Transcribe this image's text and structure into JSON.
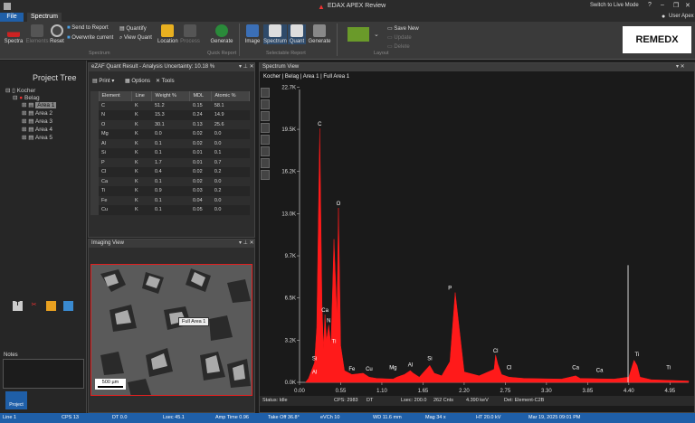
{
  "window": {
    "title": "EDAX APEX Review",
    "live_mode": "Switch to Live Mode",
    "user": "User Apex"
  },
  "menu": {
    "file": "File",
    "spectrum": "Spectrum"
  },
  "ribbon": {
    "spectra": "Spectra",
    "elements": "Elements",
    "reset": "Reset",
    "send_to_report": "Send to Report",
    "overwrite_current": "Overwrite current",
    "quantify": "Quantify",
    "view_quant": "View Quant",
    "location": "Location",
    "process": "Process",
    "generate": "Generate",
    "image": "Image",
    "spectrum": "Spectrum",
    "quant": "Quant",
    "generate2": "Generate",
    "save_new": "Save New",
    "update": "Update",
    "delete": "Delete",
    "grp_spectrum": "Spectrum",
    "grp_quick_report": "Quick Report",
    "grp_selectable_report": "Selectable Report",
    "grp_layout": "Layout",
    "logo": "REMEDX"
  },
  "project_tree": {
    "title": "Project Tree",
    "root": "Kocher",
    "sample": "Belag",
    "areas": [
      "Area 1",
      "Area 2",
      "Area 3",
      "Area 4",
      "Area 5"
    ],
    "notes": "Notes",
    "project_btn": "Project"
  },
  "quant": {
    "title": "eZAF Quant Result - Analysis Uncertainty: 10.18 %",
    "print": "Print",
    "options": "Options",
    "tools": "Tools",
    "headers": [
      "Element",
      "Line",
      "Weight %",
      "MDL",
      "Atomic %"
    ],
    "rows": [
      [
        "C",
        "K",
        "51.2",
        "0.15",
        "58.1"
      ],
      [
        "N",
        "K",
        "15.3",
        "0.24",
        "14.9"
      ],
      [
        "O",
        "K",
        "30.1",
        "0.13",
        "25.6"
      ],
      [
        "Mg",
        "K",
        "0.0",
        "0.02",
        "0.0"
      ],
      [
        "Al",
        "K",
        "0.1",
        "0.02",
        "0.0"
      ],
      [
        "Si",
        "K",
        "0.1",
        "0.01",
        "0.1"
      ],
      [
        "P",
        "K",
        "1.7",
        "0.01",
        "0.7"
      ],
      [
        "Cl",
        "K",
        "0.4",
        "0.02",
        "0.2"
      ],
      [
        "Ca",
        "K",
        "0.1",
        "0.02",
        "0.0"
      ],
      [
        "Ti",
        "K",
        "0.9",
        "0.03",
        "0.2"
      ],
      [
        "Fe",
        "K",
        "0.1",
        "0.04",
        "0.0"
      ],
      [
        "Cu",
        "K",
        "0.1",
        "0.05",
        "0.0"
      ]
    ]
  },
  "imaging": {
    "title": "Imaging View",
    "label": "Full Area 1",
    "scale": "500 µm"
  },
  "spectrum": {
    "title": "Spectrum View",
    "breadcrumb": "Kocher | Belag | Area 1 | Full Area 1",
    "status": "Status: Idle",
    "cps": "CPS: 2983",
    "dt": "DT",
    "lsec": "Lsec: 200.0",
    "cnts": "262 Cnts",
    "kev": "4.390 keV",
    "det": "Det: Element-C2B"
  },
  "chart_data": {
    "type": "line",
    "xlabel": "",
    "ylabel": "",
    "xlim": [
      0,
      5.2
    ],
    "ylim": [
      0,
      22500
    ],
    "x_ticks": [
      "0.00",
      "0.55",
      "1.10",
      "1.65",
      "2.20",
      "2.75",
      "3.30",
      "3.85",
      "4.40",
      "4.95"
    ],
    "y_ticks": [
      "0.0K",
      "3.2K",
      "6.5K",
      "9.7K",
      "13.0K",
      "16.2K",
      "19.5K",
      "22.7K"
    ],
    "y_tick_vals": [
      0,
      3240,
      6480,
      9720,
      12960,
      16200,
      19440,
      22680
    ],
    "series": [
      {
        "x": [
          0.08,
          0.12,
          0.2,
          0.23,
          0.27,
          0.3,
          0.32,
          0.34,
          0.36,
          0.39,
          0.42,
          0.46,
          0.5,
          0.52,
          0.55,
          0.6,
          0.7,
          0.85,
          0.93,
          1.03,
          1.25,
          1.3,
          1.4,
          1.48,
          1.52,
          1.6,
          1.74,
          1.8,
          1.9,
          2.01,
          2.08,
          2.2,
          2.4,
          2.6,
          2.62,
          2.65,
          2.7,
          2.8,
          3.0,
          3.5,
          3.69,
          3.75,
          4.2,
          4.4,
          4.47,
          4.51,
          4.55,
          4.7,
          5.2
        ],
        "y": [
          0,
          300,
          1500,
          4200,
          19500,
          6000,
          2600,
          5200,
          3200,
          4400,
          2800,
          11000,
          5000,
          13400,
          2800,
          900,
          600,
          700,
          400,
          300,
          250,
          400,
          600,
          900,
          700,
          400,
          1300,
          700,
          500,
          1600,
          6900,
          800,
          500,
          1000,
          2100,
          1400,
          600,
          400,
          300,
          250,
          500,
          300,
          250,
          400,
          1700,
          1300,
          400,
          200,
          100
        ]
      }
    ],
    "labels": [
      {
        "text": "C",
        "x": 0.27,
        "y": 19500
      },
      {
        "text": "O",
        "x": 0.52,
        "y": 13400
      },
      {
        "text": "P",
        "x": 2.01,
        "y": 6900
      },
      {
        "text": "Ca",
        "x": 0.34,
        "y": 5200
      },
      {
        "text": "N",
        "x": 0.39,
        "y": 4400
      },
      {
        "text": "Ti",
        "x": 0.46,
        "y": 2800
      },
      {
        "text": "Si",
        "x": 0.2,
        "y": 1500
      },
      {
        "text": "Al",
        "x": 0.2,
        "y": 450
      },
      {
        "text": "Fe",
        "x": 0.7,
        "y": 700
      },
      {
        "text": "Cu",
        "x": 0.93,
        "y": 700
      },
      {
        "text": "Mg",
        "x": 1.25,
        "y": 800
      },
      {
        "text": "Al",
        "x": 1.48,
        "y": 1000
      },
      {
        "text": "Si",
        "x": 1.74,
        "y": 1500
      },
      {
        "text": "Cl",
        "x": 2.62,
        "y": 2100
      },
      {
        "text": "Cl",
        "x": 2.8,
        "y": 800
      },
      {
        "text": "Ca",
        "x": 3.69,
        "y": 800
      },
      {
        "text": "Ca",
        "x": 4.01,
        "y": 600
      },
      {
        "text": "Ti",
        "x": 4.51,
        "y": 1800
      },
      {
        "text": "Ti",
        "x": 4.93,
        "y": 800
      }
    ],
    "cursor_x": 4.39
  },
  "statusbar": {
    "line1": "Line 1",
    "cps": "CPS 13",
    "dt": "DT 0.0",
    "lsec": "Lsec 45.1",
    "amp": "Amp Time 0.96",
    "takeoff": "Take Off 36.8°",
    "evch": "eVCh 10",
    "wd": "WD 11.6 mm",
    "mag": "Mag 34 x",
    "ht": "HT 20.0 kV",
    "date": "Mar 19, 2025 09:01 PM"
  }
}
